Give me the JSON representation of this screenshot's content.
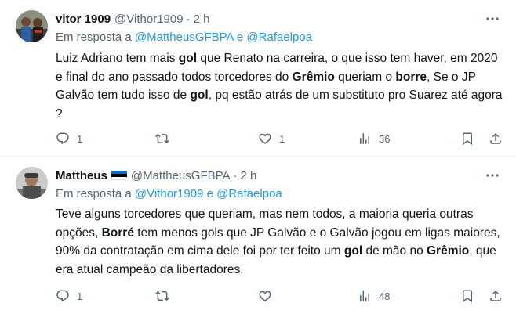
{
  "tweets": [
    {
      "name": "vitor 1909",
      "handle": "@Vithor1909",
      "separator": "·",
      "time": "2 h",
      "reply_prefix": "Em resposta a ",
      "reply_mention_1": "@MattheusGFBPA",
      "reply_conjunction": " e ",
      "reply_mention_2": "@Rafaelpoa",
      "body": [
        {
          "t": "Luiz Adriano tem mais ",
          "b": false
        },
        {
          "t": "gol",
          "b": true
        },
        {
          "t": " que Renato na carreira, o que isso tem haver, em 2020 e final do ano passado todos torcedores do ",
          "b": false
        },
        {
          "t": "Grêmio",
          "b": true
        },
        {
          "t": " queriam o ",
          "b": false
        },
        {
          "t": "borre",
          "b": true
        },
        {
          "t": ", Se o JP Galvão tem tudo isso de ",
          "b": false
        },
        {
          "t": "gol",
          "b": true
        },
        {
          "t": ", pq estão atrás de um substituto pro Suarez até agora ?",
          "b": false
        }
      ],
      "counts": {
        "reply": "1",
        "retweet": "",
        "like": "1",
        "views": "36"
      }
    },
    {
      "name": "Mattheus",
      "flag_colors": [
        "#0072ce",
        "#000000",
        "#ffffff"
      ],
      "handle": "@MattheusGFBPA",
      "separator": "·",
      "time": "2 h",
      "reply_prefix": "Em resposta a ",
      "reply_mention_1": "@Vithor1909",
      "reply_conjunction": " e ",
      "reply_mention_2": "@Rafaelpoa",
      "body": [
        {
          "t": "Teve alguns torcedores que queriam, mas nem todos, a maioria queria outras opções, ",
          "b": false
        },
        {
          "t": "Borré",
          "b": true
        },
        {
          "t": " tem menos gols que JP Galvão e o Galvão jogou em ligas maiores, 90% da contratação em cima dele foi por ter feito um ",
          "b": false
        },
        {
          "t": "gol",
          "b": true
        },
        {
          "t": " de mão no ",
          "b": false
        },
        {
          "t": "Grêmio",
          "b": true
        },
        {
          "t": ", que era atual campeão da libertadores.",
          "b": false
        }
      ],
      "counts": {
        "reply": "1",
        "retweet": "",
        "like": "",
        "views": "48"
      }
    }
  ],
  "icons": [
    "more-icon",
    "reply-icon",
    "retweet-icon",
    "like-icon",
    "views-icon",
    "bookmark-icon",
    "share-icon"
  ],
  "colors": {
    "text": "#0f1419",
    "secondary": "#536471",
    "link": "#1d9bf0",
    "divider": "#eff3f4"
  }
}
